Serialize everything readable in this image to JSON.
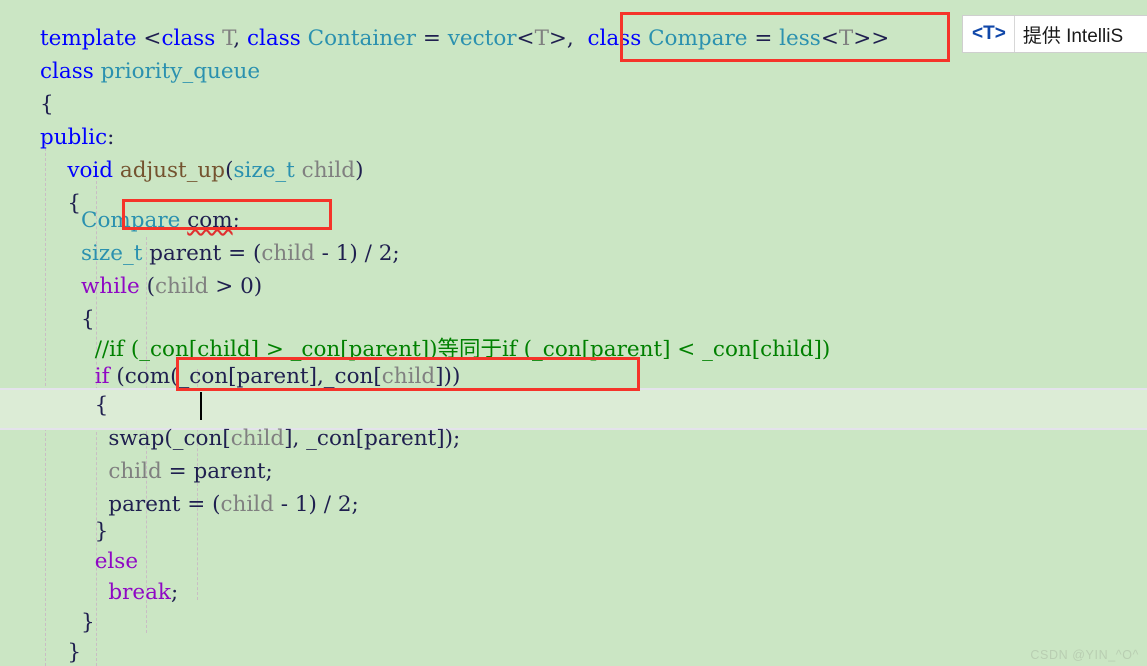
{
  "editor": {
    "background_color": "#cbe6c4",
    "current_line_color": "#dcecd6",
    "annotation_color": "#f5342a",
    "font_size_px": 21.5,
    "line_height_px": 33
  },
  "code": {
    "language": "C++",
    "lines": [
      {
        "n": 1,
        "text": "template <class T, class Container = vector<T>, class Compare = less<T>>"
      },
      {
        "n": 2,
        "text": "class priority_queue"
      },
      {
        "n": 3,
        "text": "{"
      },
      {
        "n": 4,
        "text": "public:"
      },
      {
        "n": 5,
        "text": "    void adjust_up(size_t child)"
      },
      {
        "n": 6,
        "text": "    {"
      },
      {
        "n": 7,
        "text": "        Compare com;"
      },
      {
        "n": 8,
        "text": "        size_t parent = (child - 1) / 2;"
      },
      {
        "n": 9,
        "text": "        while (child > 0)"
      },
      {
        "n": 10,
        "text": "        {"
      },
      {
        "n": 11,
        "text": "            //if (_con[child] > _con[parent])等同于if (_con[parent] < _con[child])"
      },
      {
        "n": 12,
        "text": "            if (com(_con[parent],_con[child]))"
      },
      {
        "n": 13,
        "text": "            {"
      },
      {
        "n": 14,
        "text": "                swap(_con[child], _con[parent]);"
      },
      {
        "n": 15,
        "text": "                child = parent;"
      },
      {
        "n": 16,
        "text": "                parent = (child - 1) / 2;"
      },
      {
        "n": 17,
        "text": "            }"
      },
      {
        "n": 18,
        "text": "            else"
      },
      {
        "n": 19,
        "text": "                break;"
      },
      {
        "n": 20,
        "text": "        }"
      },
      {
        "n": 21,
        "text": "    }"
      }
    ],
    "caret_line": 13,
    "error_squiggle_token": "com"
  },
  "annotations": [
    {
      "id": 1,
      "label": "class Compare = less<T>>",
      "target": "template-compare-param"
    },
    {
      "id": 2,
      "label": "Compare com;",
      "target": "compare-declaration"
    },
    {
      "id": 3,
      "label": "if (com(_con[parent],_con[child]))",
      "target": "if-comparison-call"
    }
  ],
  "tooltip": {
    "tparam": "<T>",
    "description": "提供 IntelliS"
  },
  "watermark": {
    "text": "CSDN @YIN_^O^"
  },
  "syntax_colors": {
    "keyword_blue": "#0000ff",
    "keyword_purple": "#8f08c4",
    "type_teal": "#2b91af",
    "identifier_gray": "#808080",
    "comment_green": "#008000",
    "plain": "#1f1f4f"
  }
}
